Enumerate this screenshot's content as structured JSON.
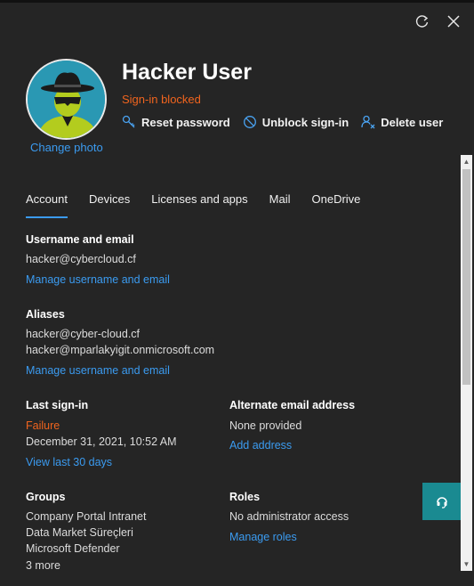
{
  "header": {
    "name": "Hacker User",
    "status": "Sign-in blocked",
    "change_photo": "Change photo",
    "actions": {
      "reset_password": "Reset password",
      "unblock_signin": "Unblock sign-in",
      "delete_user": "Delete user"
    }
  },
  "tabs": [
    "Account",
    "Devices",
    "Licenses and apps",
    "Mail",
    "OneDrive"
  ],
  "account": {
    "username_section": {
      "label": "Username and email",
      "value": "hacker@cybercloud.cf",
      "link": "Manage username and email"
    },
    "aliases_section": {
      "label": "Aliases",
      "values": [
        "hacker@cyber-cloud.cf",
        "hacker@mparlakyigit.onmicrosoft.com"
      ],
      "link": "Manage username and email"
    },
    "last_signin": {
      "label": "Last sign-in",
      "result": "Failure",
      "date": "December 31, 2021, 10:52 AM",
      "link": "View last 30 days"
    },
    "alternate_email": {
      "label": "Alternate email address",
      "value": "None provided",
      "link": "Add address"
    },
    "groups": {
      "label": "Groups",
      "values": [
        "Company Portal Intranet",
        "Data Market Süreçleri",
        "Microsoft Defender"
      ],
      "more": "3 more"
    },
    "roles": {
      "label": "Roles",
      "value": "No administrator access",
      "link": "Manage roles"
    }
  },
  "colors": {
    "accent": "#3b9bf0",
    "warning": "#f0641e",
    "fab": "#1a8a91"
  },
  "icons": [
    "refresh-icon",
    "close-icon",
    "key-icon",
    "block-icon",
    "delete-user-icon",
    "headset-icon"
  ]
}
